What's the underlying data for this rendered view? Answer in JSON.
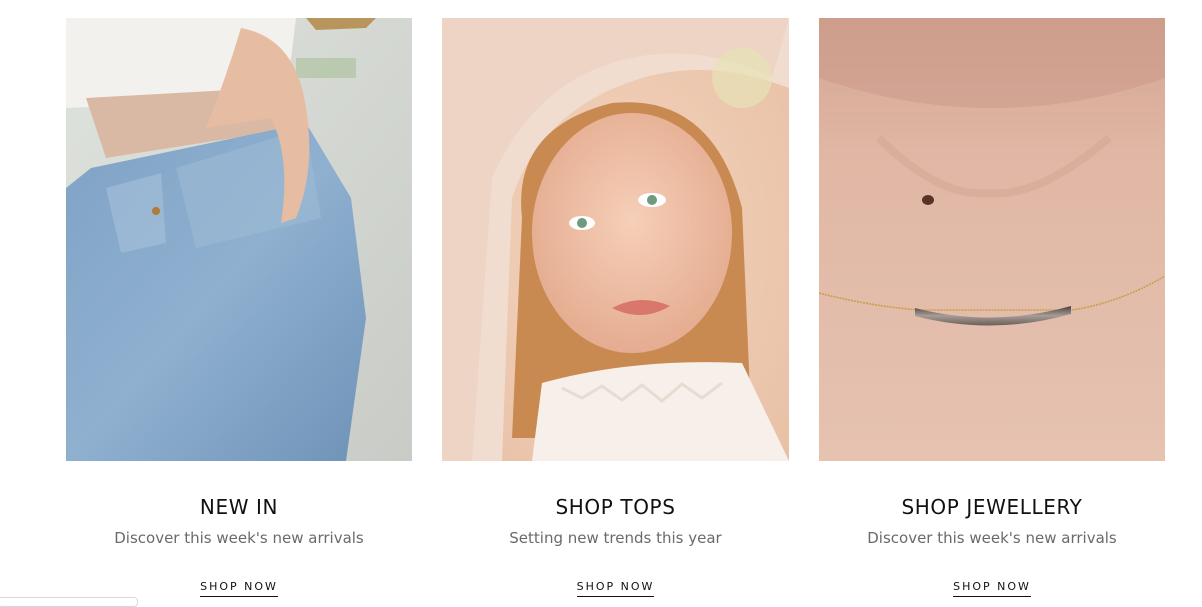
{
  "cards": [
    {
      "title": "NEW IN",
      "subtitle": "Discover this week's new arrivals",
      "link_label": "SHOP NOW",
      "image": "jeans-photo"
    },
    {
      "title": "SHOP TOPS",
      "subtitle": "Setting new trends this year",
      "link_label": "SHOP NOW",
      "image": "floral-hat-photo"
    },
    {
      "title": "SHOP JEWELLERY",
      "subtitle": "Discover this week's new arrivals",
      "link_label": "SHOP NOW",
      "image": "necklace-photo"
    }
  ],
  "colors": {
    "title": "#111111",
    "subtitle": "#6a6a6a",
    "link_underline": "#111111"
  }
}
